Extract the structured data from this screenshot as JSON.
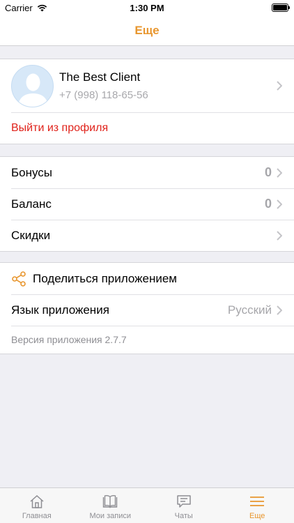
{
  "status": {
    "carrier": "Carrier",
    "time": "1:30 PM"
  },
  "nav": {
    "title": "Еще"
  },
  "profile": {
    "name": "The Best Client",
    "phone": "+7 (998) 118-65-56",
    "logout_label": "Выйти из профиля"
  },
  "account": {
    "items": [
      {
        "label": "Бонусы",
        "value": "0"
      },
      {
        "label": "Баланс",
        "value": "0"
      },
      {
        "label": "Скидки",
        "value": ""
      }
    ]
  },
  "settings": {
    "share_label": "Поделиться приложением",
    "language_label": "Язык приложения",
    "language_value": "Русский",
    "version_text": "Версия приложения 2.7.7"
  },
  "tabbar": {
    "items": [
      {
        "label": "Главная",
        "icon": "home-icon"
      },
      {
        "label": "Мои записи",
        "icon": "book-icon"
      },
      {
        "label": "Чаты",
        "icon": "chat-icon"
      },
      {
        "label": "Еще",
        "icon": "menu-icon"
      }
    ],
    "active_index": 3
  },
  "colors": {
    "accent": "#e8962e",
    "danger": "#e0231b",
    "background": "#efeff4"
  }
}
